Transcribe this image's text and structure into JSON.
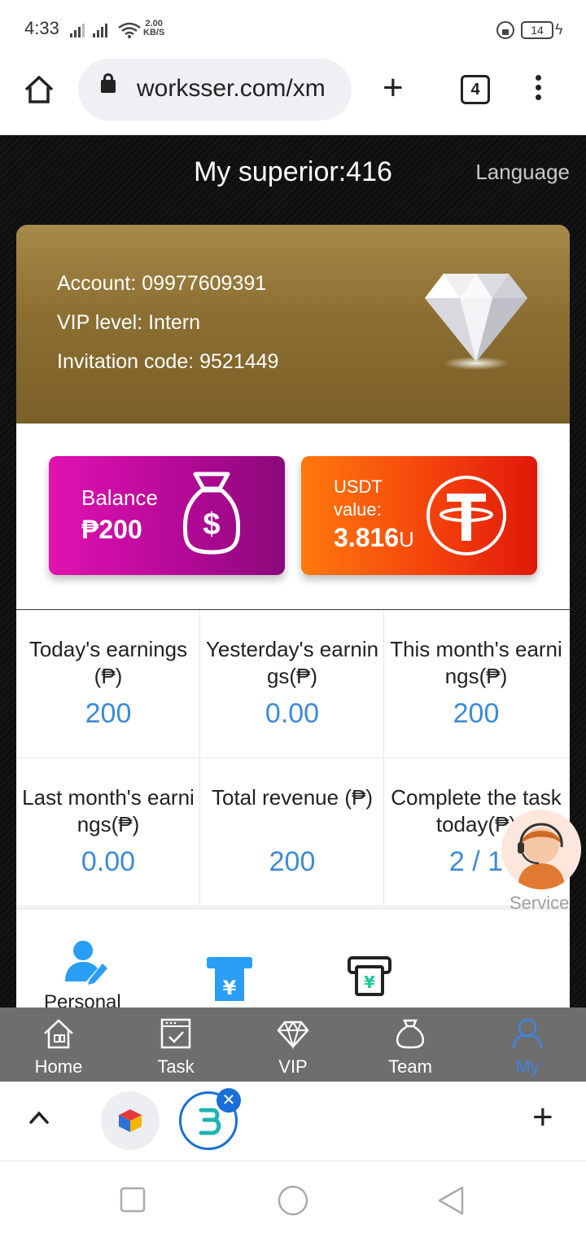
{
  "status_bar": {
    "time": "4:33",
    "speed_value": "2.00",
    "speed_unit": "KB/S",
    "battery": "14"
  },
  "browser": {
    "url": "worksser.com/xm",
    "tab_count": "4"
  },
  "header": {
    "title": "My superior:416",
    "language_label": "Language"
  },
  "account": {
    "account_line": "Account: 09977609391",
    "vip_line": "VIP level: Intern",
    "invite_line": "Invitation code: 9521449"
  },
  "balance_card": {
    "label": "Balance",
    "value": "₱200"
  },
  "usdt_card": {
    "label": "USDT value:",
    "value": "3.816",
    "unit": "U"
  },
  "stats": [
    {
      "title": "Today's earnings(₱)",
      "value": "200"
    },
    {
      "title": "Yesterday's earnings(₱)",
      "value": "0.00"
    },
    {
      "title": "This month's earnings(₱)",
      "value": "200"
    },
    {
      "title": "Last month's earnings(₱)",
      "value": "0.00"
    },
    {
      "title": "Total revenue (₱)",
      "value": "200"
    },
    {
      "title": "Complete the task today(₱)",
      "value": "2 / 1"
    }
  ],
  "service_label": "Service",
  "shortcuts": {
    "first_label_partial": "Personal"
  },
  "tabbar": {
    "items": [
      {
        "label": "Home",
        "icon": "home-icon"
      },
      {
        "label": "Task",
        "icon": "task-icon"
      },
      {
        "label": "VIP",
        "icon": "diamond-icon"
      },
      {
        "label": "Team",
        "icon": "team-icon"
      },
      {
        "label": "My",
        "icon": "user-icon"
      }
    ],
    "active": "My",
    "active_color": "#3d86e0"
  },
  "colors": {
    "gold": "#8c6f32",
    "balance": "#c10aa0",
    "usdt": "#f0440c",
    "stat_value": "#3e8ad6"
  }
}
